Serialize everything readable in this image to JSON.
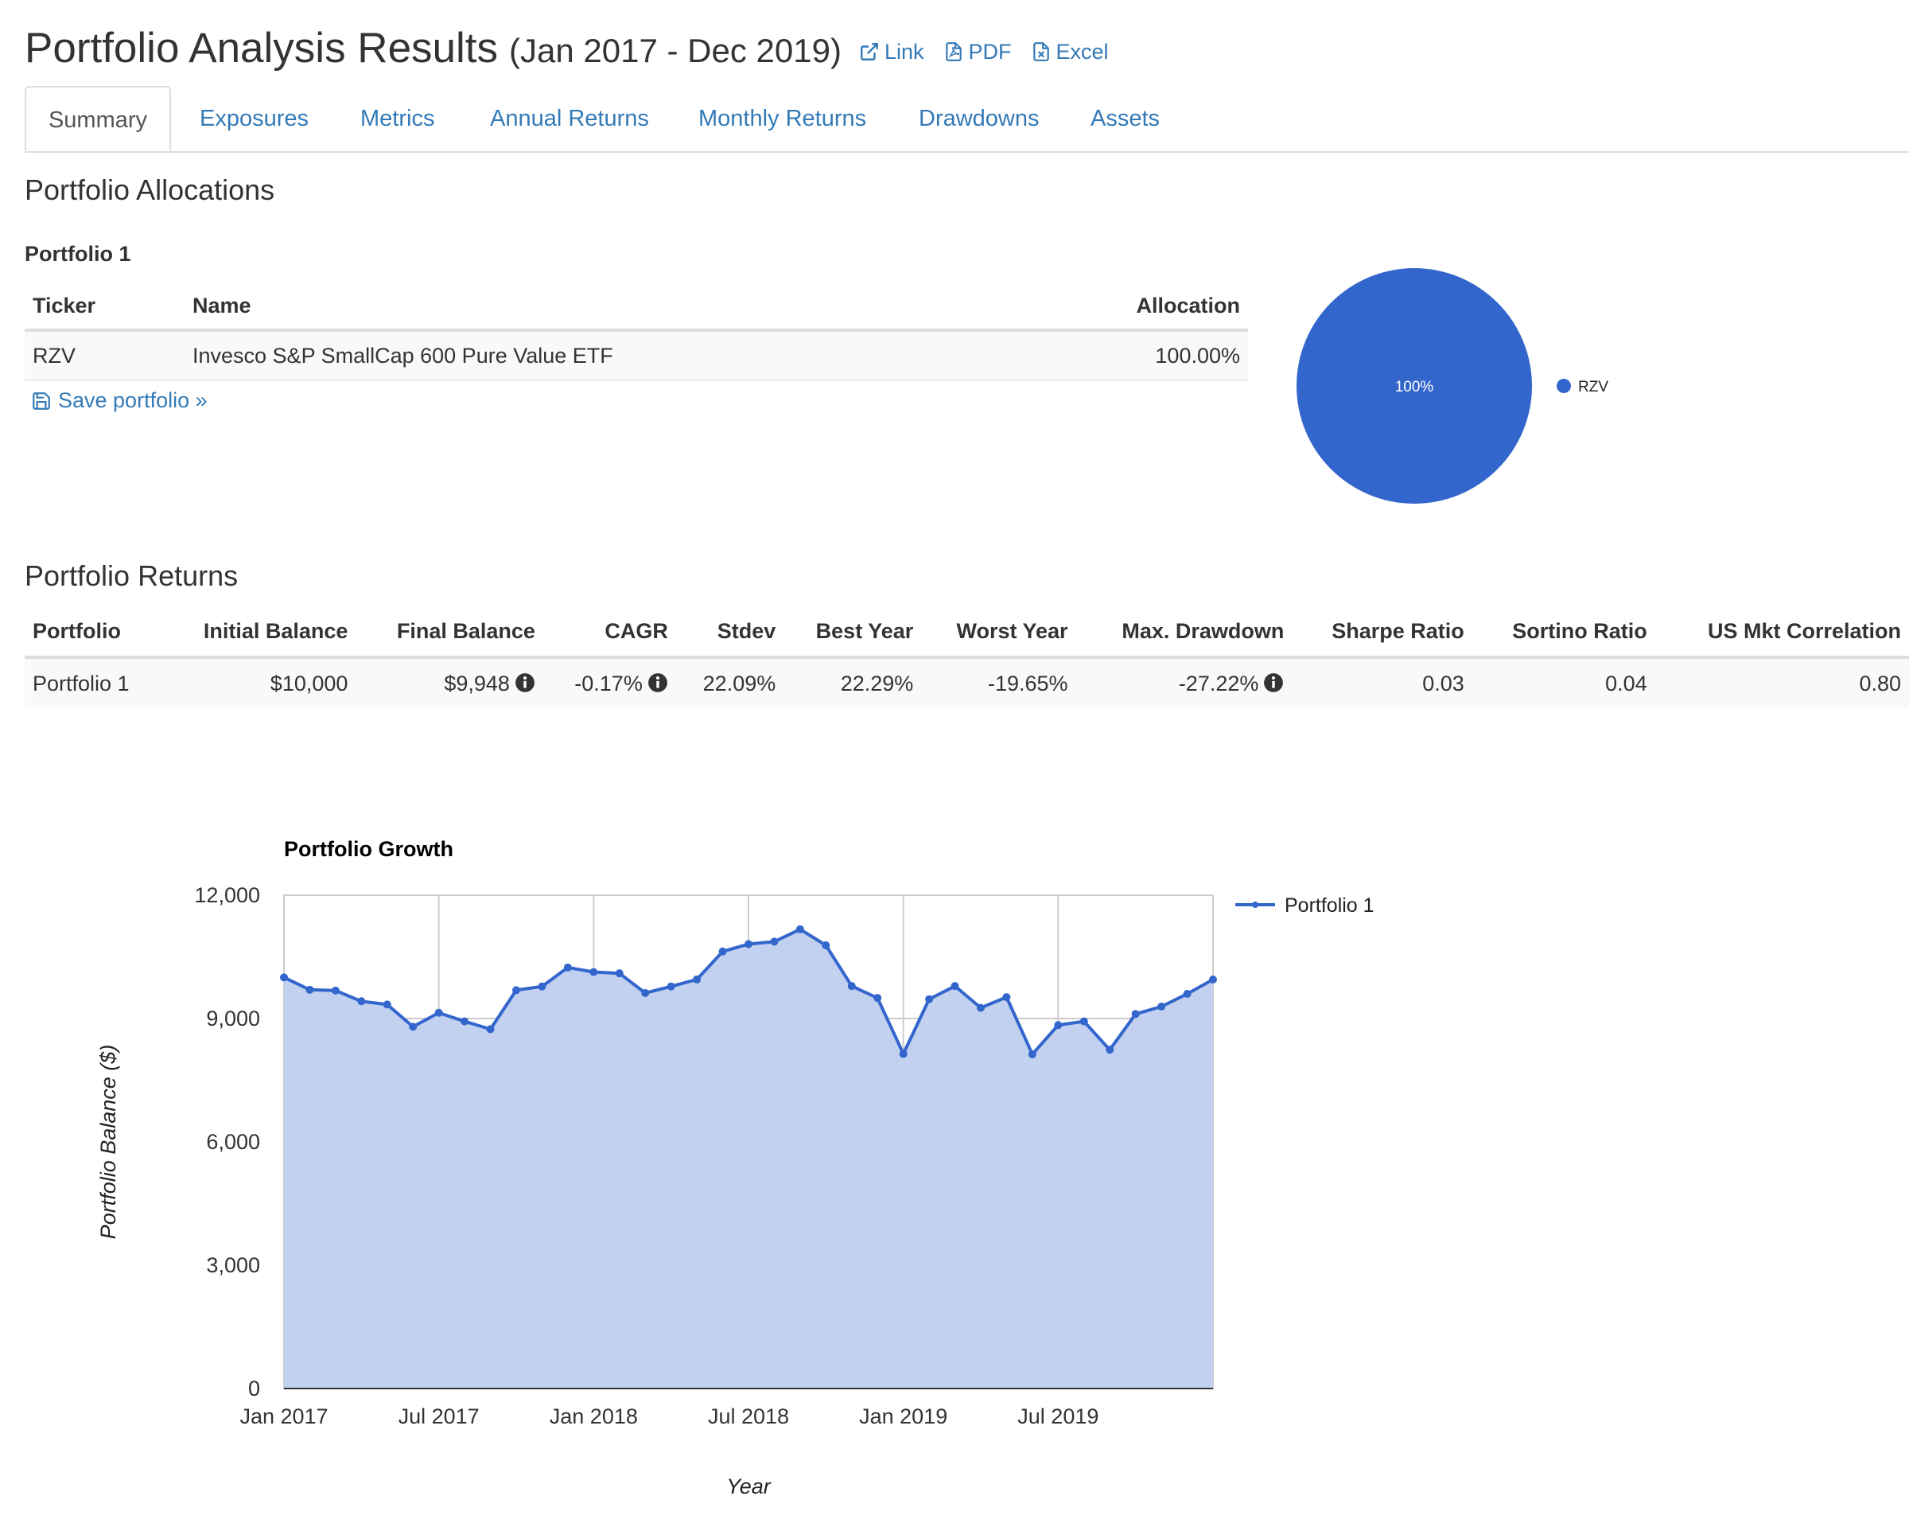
{
  "header": {
    "title": "Portfolio Analysis Results",
    "period": "(Jan 2017 - Dec 2019)",
    "links": [
      {
        "label": "Link",
        "icon": "external-link-icon"
      },
      {
        "label": "PDF",
        "icon": "pdf-file-icon"
      },
      {
        "label": "Excel",
        "icon": "excel-file-icon"
      }
    ]
  },
  "tabs": [
    {
      "label": "Summary",
      "active": true
    },
    {
      "label": "Exposures"
    },
    {
      "label": "Metrics"
    },
    {
      "label": "Annual Returns"
    },
    {
      "label": "Monthly Returns"
    },
    {
      "label": "Drawdowns"
    },
    {
      "label": "Assets"
    }
  ],
  "allocations": {
    "heading": "Portfolio Allocations",
    "portfolio_name": "Portfolio 1",
    "columns": {
      "ticker": "Ticker",
      "name": "Name",
      "allocation": "Allocation"
    },
    "rows": [
      {
        "ticker": "RZV",
        "name": "Invesco S&P SmallCap 600 Pure Value ETF",
        "allocation": "100.00%"
      }
    ],
    "save_label": "Save portfolio »"
  },
  "returns": {
    "heading": "Portfolio Returns",
    "columns": [
      "Portfolio",
      "Initial Balance",
      "Final Balance",
      "CAGR",
      "Stdev",
      "Best Year",
      "Worst Year",
      "Max. Drawdown",
      "Sharpe Ratio",
      "Sortino Ratio",
      "US Mkt Correlation"
    ],
    "row": {
      "portfolio": "Portfolio 1",
      "initial_balance": "$10,000",
      "final_balance": "$9,948",
      "cagr": "-0.17%",
      "stdev": "22.09%",
      "best_year": "22.29%",
      "worst_year": "-19.65%",
      "max_drawdown": "-27.22%",
      "sharpe": "0.03",
      "sortino": "0.04",
      "us_mkt_corr": "0.80"
    }
  },
  "colors": {
    "series": "#3366cc",
    "area": "#c2d1f0"
  },
  "chart_data": [
    {
      "type": "pie",
      "slices": [
        {
          "label": "RZV",
          "value": 100,
          "data_label": "100%"
        }
      ],
      "legend": "right"
    },
    {
      "type": "area",
      "title": "Portfolio Growth",
      "xlabel": "Year",
      "ylabel": "Portfolio Balance ($)",
      "ylim": [
        0,
        12000
      ],
      "yticks": [
        "0",
        "3,000",
        "6,000",
        "9,000",
        "12,000"
      ],
      "yticks_values": [
        0,
        3000,
        6000,
        9000,
        12000
      ],
      "xticks": [
        "Jan 2017",
        "Jul 2017",
        "Jan 2018",
        "Jul 2018",
        "Jan 2019",
        "Jul 2019"
      ],
      "grid": true,
      "legend": "top-right",
      "x_start": "Jan 2017",
      "x_end": "Jan 2020",
      "series": [
        {
          "name": "Portfolio 1",
          "values": [
            10000,
            9700,
            9680,
            9420,
            9340,
            8800,
            9140,
            8930,
            8740,
            9690,
            9780,
            10240,
            10130,
            10100,
            9620,
            9780,
            9950,
            10630,
            10810,
            10870,
            11170,
            10780,
            9790,
            9500,
            8140,
            9470,
            9790,
            9260,
            9520,
            8130,
            8840,
            8930,
            8240,
            9110,
            9290,
            9600,
            9948
          ]
        }
      ]
    }
  ]
}
